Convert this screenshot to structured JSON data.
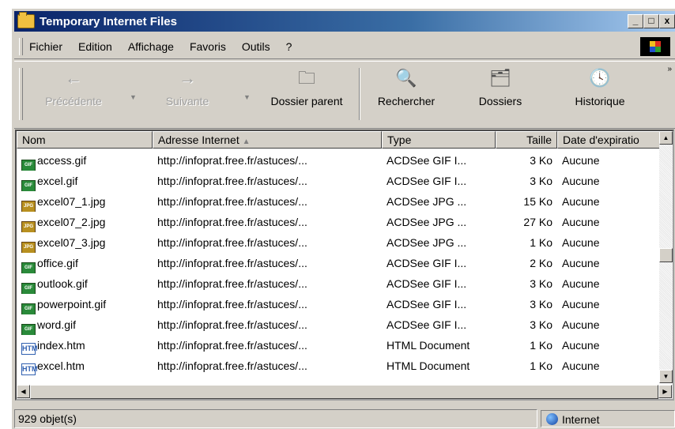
{
  "window": {
    "title": "Temporary Internet Files",
    "minimize": "_",
    "maximize": "□",
    "close": "x"
  },
  "menu": [
    "Fichier",
    "Edition",
    "Affichage",
    "Favoris",
    "Outils",
    "?"
  ],
  "toolbar": {
    "back": "Précédente",
    "forward": "Suivante",
    "up": "Dossier parent",
    "search": "Rechercher",
    "folders": "Dossiers",
    "history": "Historique"
  },
  "columns": [
    "Nom",
    "Adresse Internet",
    "Type",
    "Taille",
    "Date d'expiratio"
  ],
  "rows": [
    {
      "icon": "gif",
      "name": "access.gif",
      "url": "http://infoprat.free.fr/astuces/...",
      "type": "ACDSee GIF I...",
      "size": "3 Ko",
      "expires": "Aucune"
    },
    {
      "icon": "gif",
      "name": "excel.gif",
      "url": "http://infoprat.free.fr/astuces/...",
      "type": "ACDSee GIF I...",
      "size": "3 Ko",
      "expires": "Aucune"
    },
    {
      "icon": "jpg",
      "name": "excel07_1.jpg",
      "url": "http://infoprat.free.fr/astuces/...",
      "type": "ACDSee JPG ...",
      "size": "15 Ko",
      "expires": "Aucune"
    },
    {
      "icon": "jpg",
      "name": "excel07_2.jpg",
      "url": "http://infoprat.free.fr/astuces/...",
      "type": "ACDSee JPG ...",
      "size": "27 Ko",
      "expires": "Aucune"
    },
    {
      "icon": "jpg",
      "name": "excel07_3.jpg",
      "url": "http://infoprat.free.fr/astuces/...",
      "type": "ACDSee JPG ...",
      "size": "1 Ko",
      "expires": "Aucune"
    },
    {
      "icon": "gif",
      "name": "office.gif",
      "url": "http://infoprat.free.fr/astuces/...",
      "type": "ACDSee GIF I...",
      "size": "2 Ko",
      "expires": "Aucune"
    },
    {
      "icon": "gif",
      "name": "outlook.gif",
      "url": "http://infoprat.free.fr/astuces/...",
      "type": "ACDSee GIF I...",
      "size": "3 Ko",
      "expires": "Aucune"
    },
    {
      "icon": "gif",
      "name": "powerpoint.gif",
      "url": "http://infoprat.free.fr/astuces/...",
      "type": "ACDSee GIF I...",
      "size": "3 Ko",
      "expires": "Aucune"
    },
    {
      "icon": "gif",
      "name": "word.gif",
      "url": "http://infoprat.free.fr/astuces/...",
      "type": "ACDSee GIF I...",
      "size": "3 Ko",
      "expires": "Aucune"
    },
    {
      "icon": "htm",
      "name": "index.htm",
      "url": "http://infoprat.free.fr/astuces/...",
      "type": "HTML Document",
      "size": "1 Ko",
      "expires": "Aucune"
    },
    {
      "icon": "htm",
      "name": "excel.htm",
      "url": "http://infoprat.free.fr/astuces/...",
      "type": "HTML Document",
      "size": "1 Ko",
      "expires": "Aucune"
    }
  ],
  "status": {
    "count": "929 objet(s)",
    "zone": "Internet"
  }
}
